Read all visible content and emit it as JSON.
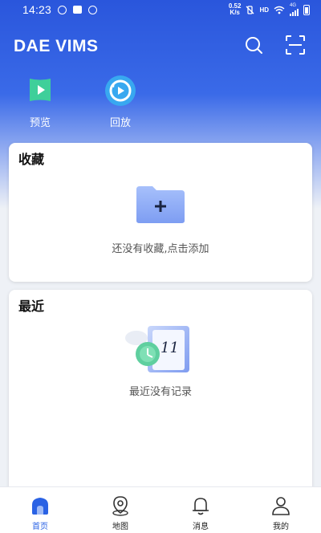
{
  "status_bar": {
    "time": "14:23",
    "net_speed_value": "0.52",
    "net_speed_unit": "K/s",
    "hd_label": "HD",
    "network_type": "4G"
  },
  "header": {
    "title": "DAE VIMS",
    "search_icon": "search-icon",
    "scan_icon": "scan-icon"
  },
  "quick_actions": [
    {
      "label": "预览",
      "icon": "play-icon"
    },
    {
      "label": "回放",
      "icon": "replay-icon"
    }
  ],
  "favorites": {
    "title": "收藏",
    "empty_text": "还没有收藏,点击添加",
    "icon": "add-folder-icon"
  },
  "recent": {
    "title": "最近",
    "empty_text": "最近没有记录",
    "calendar_day": "11",
    "icon": "calendar-clock-icon"
  },
  "tabbar": {
    "active": "首页",
    "items": [
      {
        "label": "首页",
        "icon": "home-icon"
      },
      {
        "label": "地图",
        "icon": "map-pin-icon"
      },
      {
        "label": "消息",
        "icon": "bell-icon"
      },
      {
        "label": "我的",
        "icon": "user-icon"
      }
    ]
  },
  "colors": {
    "brand_blue": "#2a56dc",
    "active_tab": "#2a62e4",
    "preview_green": "#3fcf9a"
  }
}
